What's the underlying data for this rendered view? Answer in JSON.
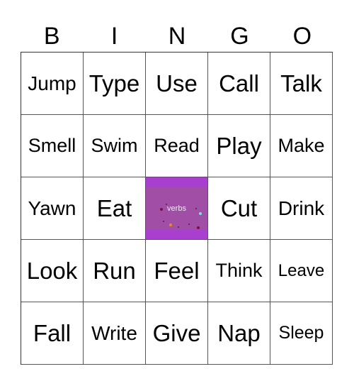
{
  "header": [
    "B",
    "I",
    "N",
    "G",
    "O"
  ],
  "free_space": {
    "label": "verbs",
    "outer_color": "#a93fcf",
    "inner_color": "#a04ea6"
  },
  "rows": [
    [
      {
        "t": "Jump",
        "s": 28
      },
      {
        "t": "Type",
        "s": 33
      },
      {
        "t": "Use",
        "s": 33
      },
      {
        "t": "Call",
        "s": 33
      },
      {
        "t": "Talk",
        "s": 33
      }
    ],
    [
      {
        "t": "Smell",
        "s": 27
      },
      {
        "t": "Swim",
        "s": 27
      },
      {
        "t": "Read",
        "s": 27
      },
      {
        "t": "Play",
        "s": 33
      },
      {
        "t": "Make",
        "s": 27
      }
    ],
    [
      {
        "t": "Yawn",
        "s": 28
      },
      {
        "t": "Eat",
        "s": 33
      },
      {
        "t": "verbs",
        "free": true
      },
      {
        "t": "Cut",
        "s": 33
      },
      {
        "t": "Drink",
        "s": 28
      }
    ],
    [
      {
        "t": "Look",
        "s": 33
      },
      {
        "t": "Run",
        "s": 33
      },
      {
        "t": "Feel",
        "s": 33
      },
      {
        "t": "Think",
        "s": 27
      },
      {
        "t": "Leave",
        "s": 24
      }
    ],
    [
      {
        "t": "Fall",
        "s": 33
      },
      {
        "t": "Write",
        "s": 28
      },
      {
        "t": "Give",
        "s": 33
      },
      {
        "t": "Nap",
        "s": 33
      },
      {
        "t": "Sleep",
        "s": 25
      }
    ]
  ]
}
